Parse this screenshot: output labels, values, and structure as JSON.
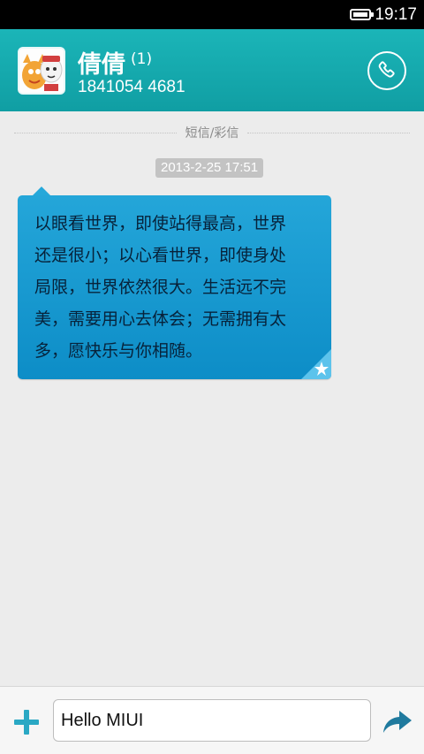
{
  "status_bar": {
    "time": "19:17",
    "battery_icon": "battery-full-icon"
  },
  "header": {
    "contact_name": "倩倩",
    "message_count": "(1)",
    "phone_number": "1841054 4681",
    "call_icon": "phone-icon",
    "avatar_icon": "avatar-icon"
  },
  "thread": {
    "channel_label": "短信/彩信",
    "messages": [
      {
        "timestamp": "2013-2-25 17:51",
        "lines": [
          "以眼看世界，即使站得最高，世界",
          "还是很小；以心看世界，即使身处",
          "局限，世界依然很大。生活远不完",
          "美，需要用心去体会；无需拥有太",
          "多，愿快乐与你相随。"
        ],
        "star_icon": "star-icon"
      }
    ]
  },
  "composer": {
    "value": "Hello MIUI",
    "add_icon": "plus-icon",
    "send_icon": "send-arrow-icon"
  },
  "colors": {
    "header": "#14a9ad",
    "bubble": "#1a9ad0",
    "accent": "#2aa8c4"
  }
}
